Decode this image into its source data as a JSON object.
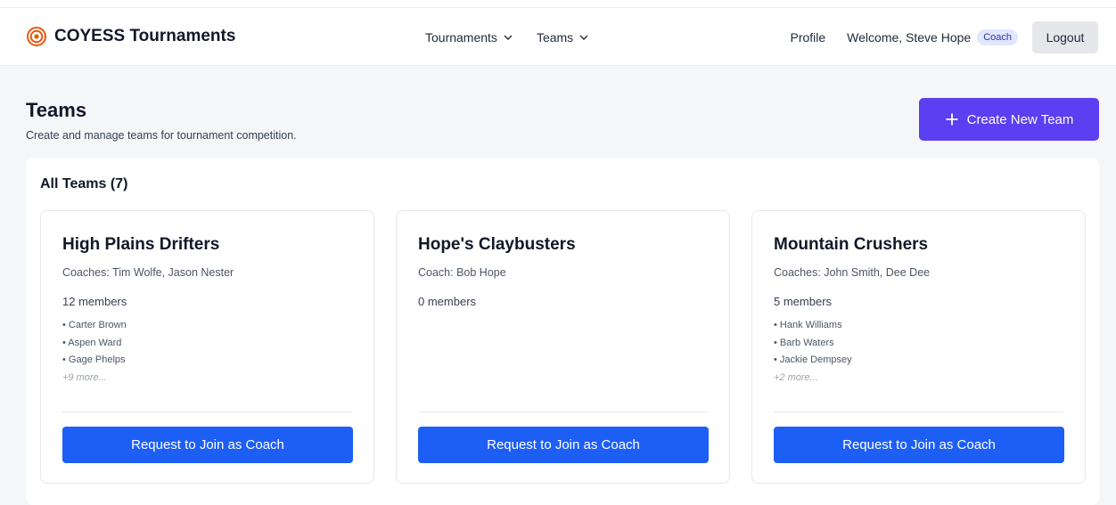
{
  "header": {
    "brand_name": "COYESS Tournaments",
    "brand_icon": "target-icon",
    "nav": [
      {
        "label": "Tournaments"
      },
      {
        "label": "Teams"
      }
    ],
    "profile_label": "Profile",
    "welcome_text": "Welcome, Steve Hope",
    "role_badge": "Coach",
    "logout_label": "Logout"
  },
  "page": {
    "title": "Teams",
    "subtitle": "Create and manage teams for tournament competition.",
    "create_button_label": "Create New Team"
  },
  "teams_panel": {
    "title": "All Teams (7)",
    "teams": [
      {
        "name": "High Plains Drifters",
        "coaches": "Coaches: Tim Wolfe, Jason Nester",
        "members_count": "12 members",
        "members": [
          "• Carter Brown",
          "• Aspen Ward",
          "• Gage Phelps"
        ],
        "more": "+9 more...",
        "action_label": "Request to Join as Coach"
      },
      {
        "name": "Hope's Claybusters",
        "coaches": "Coach: Bob Hope",
        "members_count": "0 members",
        "members": [],
        "more": "",
        "action_label": "Request to Join as Coach"
      },
      {
        "name": "Mountain Crushers",
        "coaches": "Coaches: John Smith, Dee Dee",
        "members_count": "5 members",
        "members": [
          "• Hank Williams",
          "• Barb Waters",
          "• Jackie Dempsey"
        ],
        "more": "+2 more...",
        "action_label": "Request to Join as Coach"
      }
    ]
  },
  "colors": {
    "brand_icon": "#ea580c",
    "primary_purple": "#5b3ff0",
    "primary_blue": "#1d5ff4",
    "badge_bg": "#e0e7ff",
    "badge_text": "#3730a3"
  }
}
